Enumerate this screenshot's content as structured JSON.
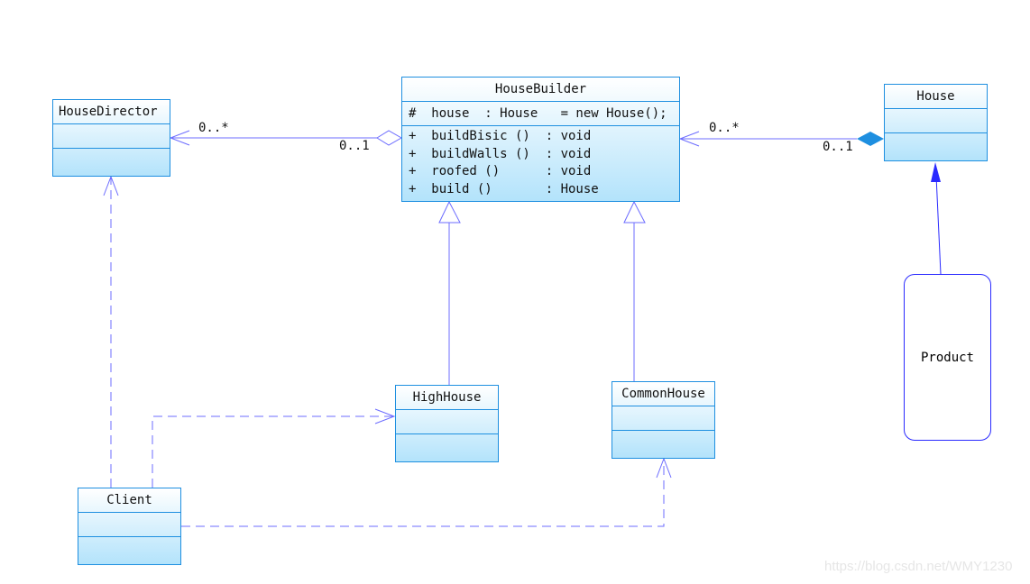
{
  "classes": {
    "director": {
      "name": "HouseDirector"
    },
    "builder": {
      "name": "HouseBuilder",
      "attribute": "#  house  : House   = new House();",
      "operations": [
        "+  buildBisic ()  : void",
        "+  buildWalls ()  : void",
        "+  roofed ()      : void",
        "+  build ()       : House"
      ]
    },
    "house": {
      "name": "House"
    },
    "high": {
      "name": "HighHouse"
    },
    "common": {
      "name": "CommonHouse"
    },
    "client": {
      "name": "Client"
    },
    "product": {
      "name": "Product"
    }
  },
  "multiplicities": {
    "director_many": "0..*",
    "director_one": "0..1",
    "house_many": "0..*",
    "house_one": "0..1"
  },
  "colors": {
    "border": "#1e8fe0",
    "line": "#7a7aff",
    "composition": "#1e8fe0"
  },
  "watermark": "https://blog.csdn.net/WMY1230"
}
